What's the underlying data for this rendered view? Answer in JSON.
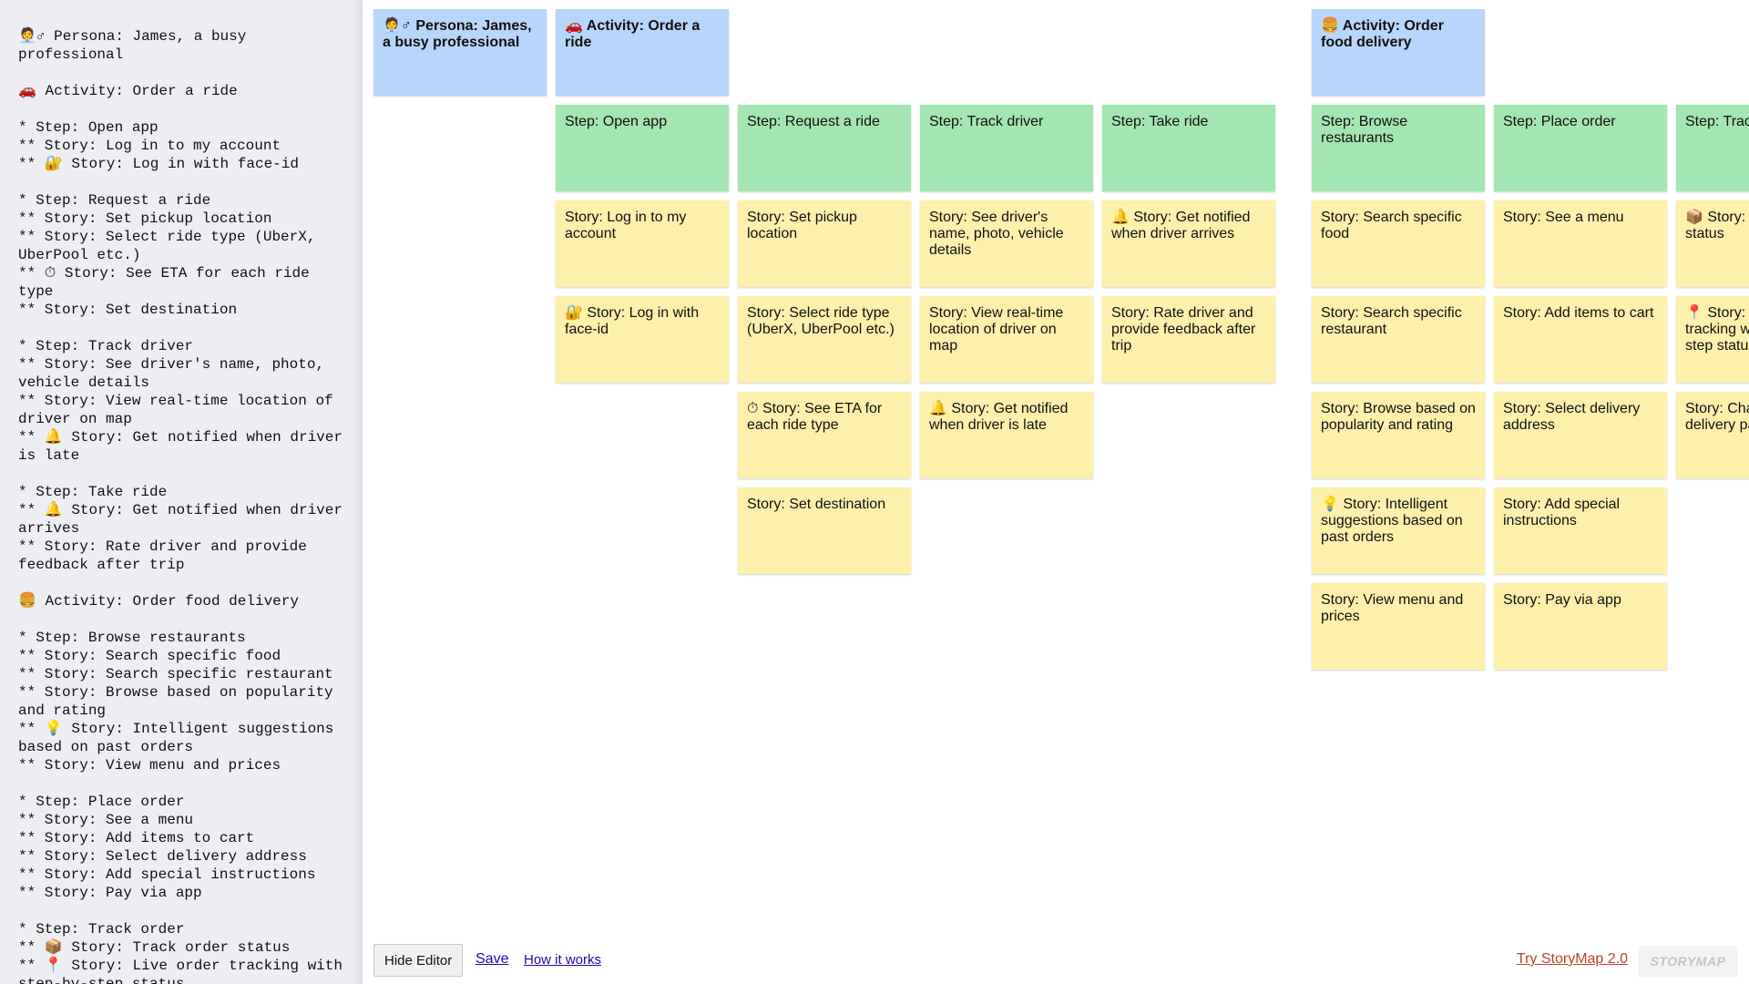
{
  "editor": {
    "text": "🧑‍💼♂ Persona: James, a busy professional\n\n🚗 Activity: Order a ride\n\n* Step: Open app\n** Story: Log in to my account\n** 🔐 Story: Log in with face-id\n\n* Step: Request a ride\n** Story: Set pickup location\n** Story: Select ride type (UberX, UberPool etc.)\n** ⏱ Story: See ETA for each ride type\n** Story: Set destination\n\n* Step: Track driver\n** Story: See driver's name, photo, vehicle details\n** Story: View real-time location of driver on map\n** 🔔 Story: Get notified when driver is late\n\n* Step: Take ride\n** 🔔 Story: Get notified when driver arrives\n** Story: Rate driver and provide feedback after trip\n\n🍔 Activity: Order food delivery\n\n* Step: Browse restaurants\n** Story: Search specific food\n** Story: Search specific restaurant\n** Story: Browse based on popularity and rating\n** 💡 Story: Intelligent suggestions based on past orders\n** Story: View menu and prices\n\n* Step: Place order\n** Story: See a menu\n** Story: Add items to cart\n** Story: Select delivery address\n** Story: Add special instructions\n** Story: Pay via app\n\n* Step: Track order\n** 📦 Story: Track order status\n** 📍 Story: Live order tracking with step-by-step status\n** Story: Chat with delivery partner"
  },
  "map": {
    "persona": {
      "glyph": "🧑‍💼♂",
      "label": "Persona: James, a busy professional"
    },
    "activities": [
      {
        "glyph": "🚗",
        "label": "Activity: Order a ride"
      },
      {
        "glyph": "🍔",
        "label": "Activity: Order food delivery"
      }
    ],
    "steps": [
      {
        "label": "Step: Open app",
        "stories": [
          {
            "glyph": "",
            "label": "Story: Log in to my account"
          },
          {
            "glyph": "🔐",
            "label": "Story: Log in with face-id"
          }
        ]
      },
      {
        "label": "Step: Request a ride",
        "stories": [
          {
            "glyph": "",
            "label": "Story: Set pickup location"
          },
          {
            "glyph": "",
            "label": "Story: Select ride type (UberX, UberPool etc.)"
          },
          {
            "glyph": "⏱",
            "label": "Story: See ETA for each ride type"
          },
          {
            "glyph": "",
            "label": "Story: Set destination"
          }
        ]
      },
      {
        "label": "Step: Track driver",
        "stories": [
          {
            "glyph": "",
            "label": "Story: See driver's name, photo, vehicle details"
          },
          {
            "glyph": "",
            "label": "Story: View real-time location of driver on map"
          },
          {
            "glyph": "🔔",
            "label": "Story: Get notified when driver is late"
          }
        ]
      },
      {
        "label": "Step: Take ride",
        "stories": [
          {
            "glyph": "🔔",
            "label": "Story: Get notified when driver arrives"
          },
          {
            "glyph": "",
            "label": "Story: Rate driver and provide feedback after trip"
          }
        ]
      },
      {
        "label": "Step: Browse restaurants",
        "stories": [
          {
            "glyph": "",
            "label": "Story: Search specific food"
          },
          {
            "glyph": "",
            "label": "Story: Search specific restaurant"
          },
          {
            "glyph": "",
            "label": "Story: Browse based on popularity and rating"
          },
          {
            "glyph": "💡",
            "label": "Story: Intelligent suggestions based on past orders"
          },
          {
            "glyph": "",
            "label": "Story: View menu and prices"
          }
        ]
      },
      {
        "label": "Step: Place order",
        "stories": [
          {
            "glyph": "",
            "label": "Story: See a menu"
          },
          {
            "glyph": "",
            "label": "Story: Add items to cart"
          },
          {
            "glyph": "",
            "label": "Story: Select delivery address"
          },
          {
            "glyph": "",
            "label": "Story: Add special instructions"
          },
          {
            "glyph": "",
            "label": "Story: Pay via app"
          }
        ]
      },
      {
        "label": "Step: Track order",
        "stories": [
          {
            "glyph": "📦",
            "label": "Story: Track order status"
          },
          {
            "glyph": "📍",
            "label": "Story: Live order tracking with step-by-step status"
          },
          {
            "glyph": "",
            "label": "Story: Chat with delivery partner"
          }
        ]
      }
    ]
  },
  "toolbar": {
    "hide_editor": "Hide Editor",
    "save": "Save",
    "how_it_works": "How it works",
    "try_storymap": "Try StoryMap 2.0",
    "logo": "STORYMAP"
  }
}
